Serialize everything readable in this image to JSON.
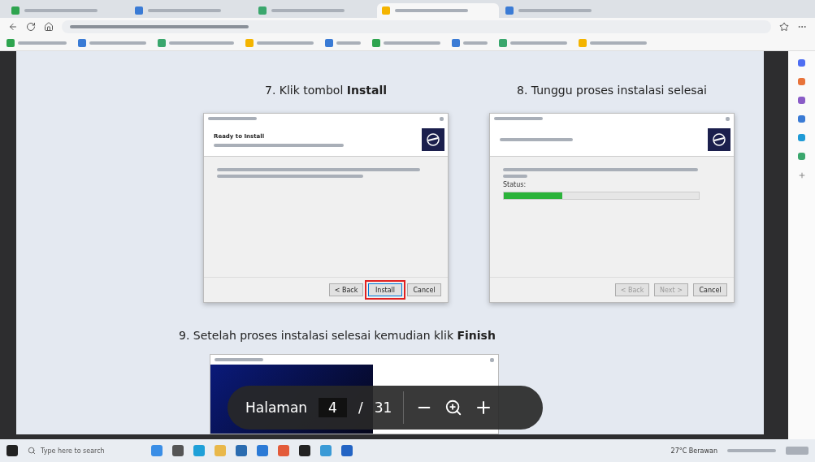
{
  "browser": {
    "tabs": [
      {
        "selected": false
      },
      {
        "selected": false
      },
      {
        "selected": false
      },
      {
        "selected": true
      },
      {
        "selected": false
      }
    ]
  },
  "slide": {
    "steps": [
      {
        "text": "7. Klik tombol **Install**"
      },
      {
        "text": "8. Tunggu proses instalasi selesai"
      },
      {
        "text": "9. Setelah proses instalasi selesai kemudian klik **Finish**"
      }
    ],
    "dialogs": [
      {
        "kind": "ready",
        "heading": "Ready to Install",
        "buttons": [
          {
            "label": "< Back",
            "highlighted": false,
            "disabled": false
          },
          {
            "label": "Install",
            "highlighted": true,
            "disabled": false
          },
          {
            "label": "Cancel",
            "highlighted": false,
            "disabled": false
          }
        ]
      },
      {
        "kind": "progress",
        "status": "Status:",
        "level": 0.3,
        "buttons": [
          {
            "label": "< Back",
            "highlighted": false,
            "disabled": true
          },
          {
            "label": "Next >",
            "highlighted": false,
            "disabled": true
          },
          {
            "label": "Cancel",
            "highlighted": false,
            "disabled": false
          }
        ]
      }
    ]
  },
  "viewer_toolbar": {
    "page_label": "Halaman",
    "page": "4",
    "separator": "/",
    "total": "31"
  },
  "taskbar": {
    "search_placeholder": "Type here to search",
    "weather": "27°C Berawan"
  }
}
